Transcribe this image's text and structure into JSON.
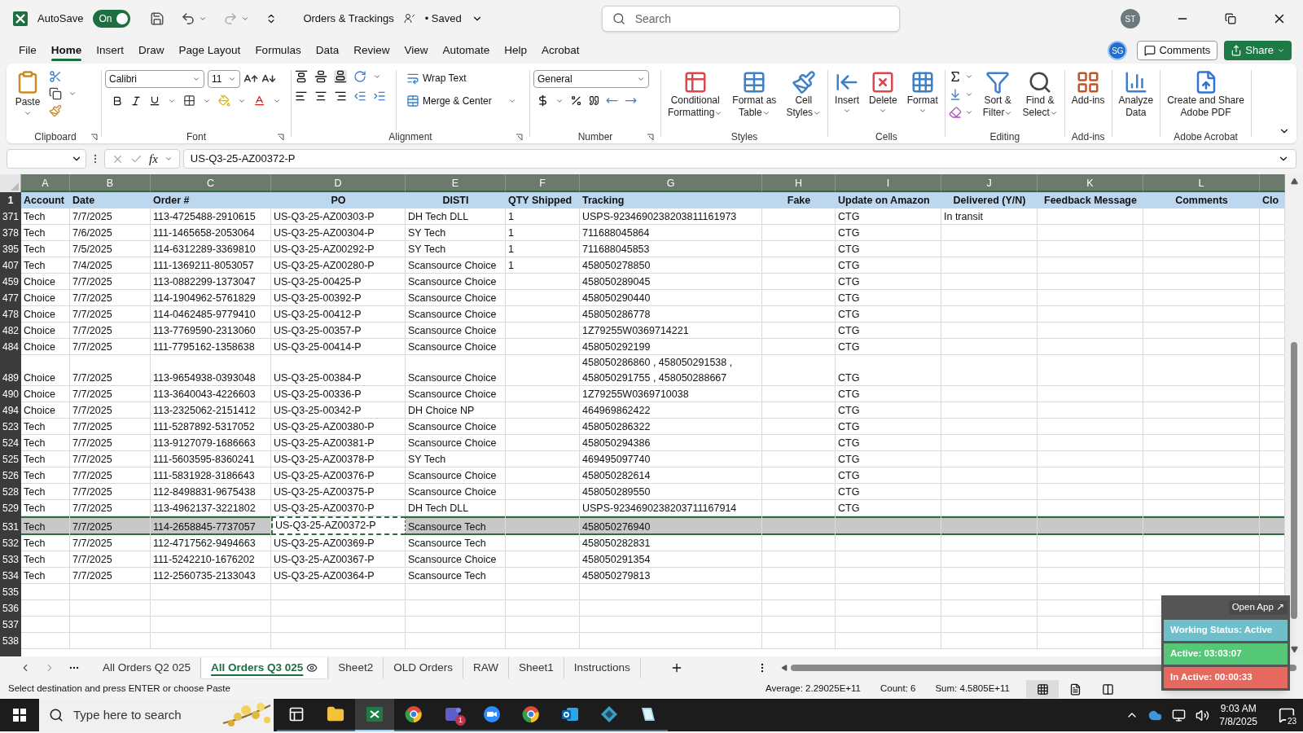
{
  "title_bar": {
    "autosave": {
      "label": "AutoSave",
      "toggle_text": "On",
      "on": true
    },
    "document": "Orders & Trackings",
    "save_status": "• Saved",
    "search": {
      "placeholder": "Search"
    },
    "user_initials": "ST"
  },
  "menu_tabs": [
    {
      "label": "File",
      "selected": false
    },
    {
      "label": "Home",
      "selected": true
    },
    {
      "label": "Insert",
      "selected": false
    },
    {
      "label": "Draw",
      "selected": false
    },
    {
      "label": "Page Layout",
      "selected": false
    },
    {
      "label": "Formulas",
      "selected": false
    },
    {
      "label": "Data",
      "selected": false
    },
    {
      "label": "Review",
      "selected": false
    },
    {
      "label": "View",
      "selected": false
    },
    {
      "label": "Automate",
      "selected": false
    },
    {
      "label": "Help",
      "selected": false
    },
    {
      "label": "Acrobat",
      "selected": false
    }
  ],
  "account_initials": "SG",
  "comments_button": "Comments",
  "share_button": "Share",
  "ribbon": {
    "clipboard": {
      "label": "Clipboard",
      "paste": "Paste"
    },
    "font": {
      "label": "Font",
      "name": "Calibri",
      "size": "11"
    },
    "alignment": {
      "label": "Alignment",
      "wrap_text": "Wrap Text",
      "merge": "Merge & Center"
    },
    "number": {
      "label": "Number",
      "format": "General"
    },
    "large_groups": [
      {
        "kind": "plain",
        "label": "Styles",
        "buttons": [
          {
            "lines": [
              "Conditional",
              "Formatting"
            ],
            "dropdown": true
          },
          {
            "lines": [
              "Format as",
              "Table"
            ],
            "dropdown": true
          },
          {
            "lines": [
              "Cell",
              "Styles"
            ],
            "dropdown": true
          }
        ]
      },
      {
        "kind": "plain",
        "label": "Cells",
        "buttons": [
          {
            "lines": [
              "Insert"
            ],
            "dropdown": true
          },
          {
            "lines": [
              "Delete"
            ],
            "dropdown": true
          },
          {
            "lines": [
              "Format"
            ],
            "dropdown": true
          }
        ]
      },
      {
        "kind": "editing",
        "label": "Editing",
        "buttons": [
          {
            "lines": [
              "Sort &",
              "Filter"
            ],
            "dropdown": true
          },
          {
            "lines": [
              "Find &",
              "Select"
            ],
            "dropdown": true
          }
        ]
      },
      {
        "kind": "plain",
        "label": "Add-ins",
        "buttons": [
          {
            "lines": [
              "Add-ins"
            ],
            "dropdown": false
          }
        ]
      },
      {
        "kind": "plain",
        "buttons": [
          {
            "lines": [
              "Analyze",
              "Data"
            ],
            "dropdown": false
          }
        ]
      },
      {
        "kind": "plain",
        "label": "Adobe Acrobat",
        "buttons": [
          {
            "lines": [
              "Create and Share",
              "Adobe PDF"
            ],
            "dropdown": false
          }
        ]
      }
    ]
  },
  "formula_bar": {
    "fx": "fx",
    "value": "US-Q3-25-AZ00372-P"
  },
  "columns": [
    "A",
    "B",
    "C",
    "D",
    "E",
    "F",
    "G",
    "H",
    "I",
    "J",
    "K",
    "L"
  ],
  "header_row": {
    "number": "1",
    "cells": [
      "Account",
      "Date",
      "Order #",
      "PO",
      "DISTI",
      "QTY Shipped",
      "Tracking",
      "Fake",
      "Update on Amazon",
      "Delivered (Y/N)",
      "Feedback Message",
      "Comments",
      "Clo"
    ]
  },
  "rows": [
    {
      "number": "371",
      "selected": false,
      "cells": [
        "Tech",
        "7/7/2025",
        "113-4725488-2910615",
        "US-Q3-25-AZ00303-P",
        "DH Tech DLL",
        "1",
        "USPS-9234690238203811161973",
        "",
        "CTG",
        "In transit",
        "",
        ""
      ]
    },
    {
      "number": "378",
      "selected": false,
      "cells": [
        "Tech",
        "7/6/2025",
        "111-1465658-2053064",
        "US-Q3-25-AZ00304-P",
        "SY Tech",
        "1",
        "711688045864",
        "",
        "CTG",
        "",
        "",
        ""
      ]
    },
    {
      "number": "395",
      "selected": false,
      "cells": [
        "Tech",
        "7/5/2025",
        "114-6312289-3369810",
        "US-Q3-25-AZ00292-P",
        "SY Tech",
        "1",
        "711688045853",
        "",
        "CTG",
        "",
        "",
        ""
      ]
    },
    {
      "number": "407",
      "selected": false,
      "cells": [
        "Tech",
        "7/4/2025",
        "111-1369211-8053057",
        "US-Q3-25-AZ00280-P",
        "Scansource Choice",
        "1",
        "458050278850",
        "",
        "CTG",
        "",
        "",
        ""
      ]
    },
    {
      "number": "459",
      "selected": false,
      "cells": [
        "Choice",
        "7/7/2025",
        "113-0882299-1373047",
        "US-Q3-25-00425-P",
        "Scansource Choice",
        "",
        "458050289045",
        "",
        "CTG",
        "",
        "",
        ""
      ]
    },
    {
      "number": "477",
      "selected": false,
      "cells": [
        "Choice",
        "7/7/2025",
        "114-1904962-5761829",
        "US-Q3-25-00392-P",
        "Scansource Choice",
        "",
        "458050290440",
        "",
        "CTG",
        "",
        "",
        ""
      ]
    },
    {
      "number": "478",
      "selected": false,
      "cells": [
        "Choice",
        "7/7/2025",
        "114-0462485-9779410",
        "US-Q3-25-00412-P",
        "Scansource Choice",
        "",
        "458050286778",
        "",
        "CTG",
        "",
        "",
        ""
      ]
    },
    {
      "number": "482",
      "selected": false,
      "cells": [
        "Choice",
        "7/7/2025",
        "113-7769590-2313060",
        "US-Q3-25-00357-P",
        "Scansource Choice",
        "",
        "1Z79255W0369714221",
        "",
        "CTG",
        "",
        "",
        ""
      ]
    },
    {
      "number": "484",
      "selected": false,
      "cells": [
        "Choice",
        "7/7/2025",
        "111-7795162-1358638",
        "US-Q3-25-00414-P",
        "Scansource Choice",
        "",
        "458050292199",
        "",
        "CTG",
        "",
        "",
        ""
      ]
    },
    {
      "number": "489",
      "selected": false,
      "cells": [
        "Choice",
        "7/7/2025",
        "113-9654938-0393048",
        "US-Q3-25-00384-P",
        "Scansource Choice",
        "",
        "458050286860 , 458050291538 , 458050291755 , 458050288667",
        "",
        "CTG",
        "",
        "",
        ""
      ]
    },
    {
      "number": "490",
      "selected": false,
      "cells": [
        "Choice",
        "7/7/2025",
        "113-3640043-4226603",
        "US-Q3-25-00336-P",
        "Scansource Choice",
        "",
        "1Z79255W0369710038",
        "",
        "CTG",
        "",
        "",
        ""
      ]
    },
    {
      "number": "494",
      "selected": false,
      "cells": [
        "Choice",
        "7/7/2025",
        "113-2325062-2151412",
        "US-Q3-25-00342-P",
        "DH Choice NP",
        "",
        "464969862422",
        "",
        "CTG",
        "",
        "",
        ""
      ]
    },
    {
      "number": "523",
      "selected": false,
      "cells": [
        "Tech",
        "7/7/2025",
        "111-5287892-5317052",
        "US-Q3-25-AZ00380-P",
        "Scansource Choice",
        "",
        "458050286322",
        "",
        "CTG",
        "",
        "",
        ""
      ]
    },
    {
      "number": "524",
      "selected": false,
      "cells": [
        "Tech",
        "7/7/2025",
        "113-9127079-1686663",
        "US-Q3-25-AZ00381-P",
        "Scansource Choice",
        "",
        "458050294386",
        "",
        "CTG",
        "",
        "",
        ""
      ]
    },
    {
      "number": "525",
      "selected": false,
      "cells": [
        "Tech",
        "7/7/2025",
        "111-5603595-8360241",
        "US-Q3-25-AZ00378-P",
        "SY Tech",
        "",
        "469495097740",
        "",
        "CTG",
        "",
        "",
        ""
      ]
    },
    {
      "number": "526",
      "selected": false,
      "cells": [
        "Tech",
        "7/7/2025",
        "111-5831928-3186643",
        "US-Q3-25-AZ00376-P",
        "Scansource Choice",
        "",
        "458050282614",
        "",
        "CTG",
        "",
        "",
        ""
      ]
    },
    {
      "number": "528",
      "selected": false,
      "cells": [
        "Tech",
        "7/7/2025",
        "112-8498831-9675438",
        "US-Q3-25-AZ00375-P",
        "Scansource Choice",
        "",
        "458050289550",
        "",
        "CTG",
        "",
        "",
        ""
      ]
    },
    {
      "number": "529",
      "selected": false,
      "cells": [
        "Tech",
        "7/7/2025",
        "113-4962137-3221802",
        "US-Q3-25-AZ00370-P",
        "DH Tech DLL",
        "",
        "USPS-9234690238203711167914",
        "",
        "CTG",
        "",
        "",
        ""
      ]
    },
    {
      "number": "531",
      "selected": true,
      "cells": [
        "Tech",
        "7/7/2025",
        "114-2658845-7737057",
        {
          "text": "US-Q3-25-AZ00372-P",
          "active": true
        },
        "Scansource Tech",
        "",
        "458050276940",
        "",
        "",
        "",
        "",
        ""
      ]
    },
    {
      "number": "532",
      "selected": false,
      "cells": [
        "Tech",
        "7/7/2025",
        "112-4717562-9494663",
        "US-Q3-25-AZ00369-P",
        "Scansource Tech",
        "",
        "458050282831",
        "",
        "",
        "",
        "",
        ""
      ]
    },
    {
      "number": "533",
      "selected": false,
      "cells": [
        "Tech",
        "7/7/2025",
        "111-5242210-1676202",
        "US-Q3-25-AZ00367-P",
        "Scansource Choice",
        "",
        "458050291354",
        "",
        "",
        "",
        "",
        ""
      ]
    },
    {
      "number": "534",
      "selected": false,
      "cells": [
        "Tech",
        "7/7/2025",
        "112-2560735-2133043",
        "US-Q3-25-AZ00364-P",
        "Scansource Tech",
        "",
        "458050279813",
        "",
        "",
        "",
        "",
        ""
      ]
    }
  ],
  "empty_rows": [
    "535",
    "536",
    "537",
    "538"
  ],
  "sheet_tabs": [
    {
      "label": "All Orders Q2 025",
      "selected": false
    },
    {
      "label": "All Orders Q3 025",
      "selected": true
    },
    {
      "label": "Sheet2",
      "selected": false
    },
    {
      "label": "OLD Orders",
      "selected": false
    },
    {
      "label": "RAW",
      "selected": false
    },
    {
      "label": "Sheet1",
      "selected": false
    },
    {
      "label": "Instructions",
      "selected": false
    }
  ],
  "status_bar": {
    "message": "Select destination and press ENTER or choose Paste",
    "average": "Average: 2.29025E+11",
    "count": "Count: 6",
    "sum": "Sum: 4.5805E+11",
    "views": [
      {
        "selected": true
      },
      {
        "selected": false
      },
      {
        "selected": false
      }
    ]
  },
  "tracker_widget": {
    "open_app": "Open App ↗",
    "statuses": [
      {
        "text": "Working Status: Active",
        "color": "#6fbfcb"
      },
      {
        "text": "Active: 03:03:07",
        "color": "#55c878"
      },
      {
        "text": "In Active: 00:00:33",
        "color": "#e5695e"
      }
    ]
  },
  "taskbar": {
    "search_placeholder": "Type here to search",
    "apps": [
      {
        "active": false
      },
      {
        "active": false
      },
      {
        "active": true
      },
      {
        "active": false
      },
      {
        "active": false
      },
      {
        "active": false
      },
      {
        "active": false
      },
      {
        "active": false
      },
      {
        "active": false
      },
      {
        "active": false
      }
    ],
    "chat_badge": "1",
    "time": "9:03 AM",
    "date": "7/8/2025",
    "notifications": "23"
  }
}
